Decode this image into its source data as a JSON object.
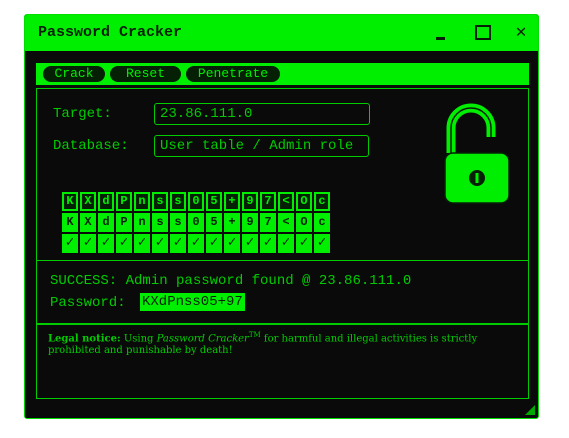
{
  "window": {
    "title": "Password Cracker"
  },
  "toolbar": {
    "crack": "Crack",
    "reset": "Reset",
    "penetrate": "Penetrate"
  },
  "form": {
    "target_label": "Target:",
    "target_value": "23.86.111.0",
    "database_label": "Database:",
    "database_value": "User table / Admin role"
  },
  "grid": {
    "row1": [
      "K",
      "X",
      "d",
      "P",
      "n",
      "s",
      "s",
      "0",
      "5",
      "+",
      "9",
      "7",
      "<",
      "O",
      "c"
    ],
    "row2": [
      "K",
      "X",
      "d",
      "P",
      "n",
      "s",
      "s",
      "0",
      "5",
      "+",
      "9",
      "7",
      "<",
      "O",
      "c"
    ],
    "row3": [
      "✓",
      "✓",
      "✓",
      "✓",
      "✓",
      "✓",
      "✓",
      "✓",
      "✓",
      "✓",
      "✓",
      "✓",
      "✓",
      "✓",
      "✓"
    ]
  },
  "status": {
    "success": "SUCCESS: Admin password found @ 23.86.111.0",
    "password_label": "Password:",
    "password_value": "KXdPnss05+97"
  },
  "legal": {
    "heading": "Legal notice:",
    "text1": "Using",
    "product": "Password Cracker",
    "tm": "TM",
    "text2": "for harmful and illegal activities is strictly prohibited and punishable by death!"
  },
  "colors": {
    "accent": "#00ee00",
    "background": "#0a0a0a",
    "dark_text": "#062006"
  }
}
